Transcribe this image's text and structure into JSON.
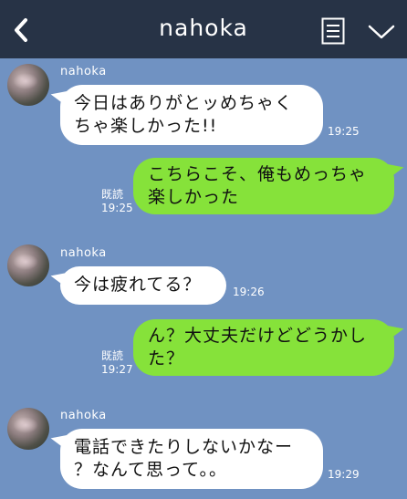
{
  "header": {
    "title": "nahoka"
  },
  "icons": {
    "back": "back-arrow-icon",
    "menu": "note-list-icon",
    "chevron": "chevron-down-icon"
  },
  "colors": {
    "background": "#7092c2",
    "header": "#273346",
    "outgoing": "#86e23a",
    "incoming": "#ffffff"
  },
  "messages": [
    {
      "side": "left",
      "sender": "nahoka",
      "lines": [
        "今日はありがとッめちゃく",
        "ちゃ楽しかった!!"
      ],
      "time": "19:25"
    },
    {
      "side": "right",
      "lines": [
        "こちらこそ、俺もめっちゃ",
        "楽しかった"
      ],
      "read": "既読",
      "time": "19:25"
    },
    {
      "side": "left",
      "sender": "nahoka",
      "lines": [
        "今は疲れてる？"
      ],
      "time": "19:26"
    },
    {
      "side": "right",
      "lines": [
        "ん？大丈夫だけどどうかし",
        "た？"
      ],
      "read": "既読",
      "time": "19:27"
    },
    {
      "side": "left",
      "sender": "nahoka",
      "lines": [
        "電話できたりしないかなー",
        "？なんて思って。。"
      ],
      "time": "19:29"
    }
  ]
}
